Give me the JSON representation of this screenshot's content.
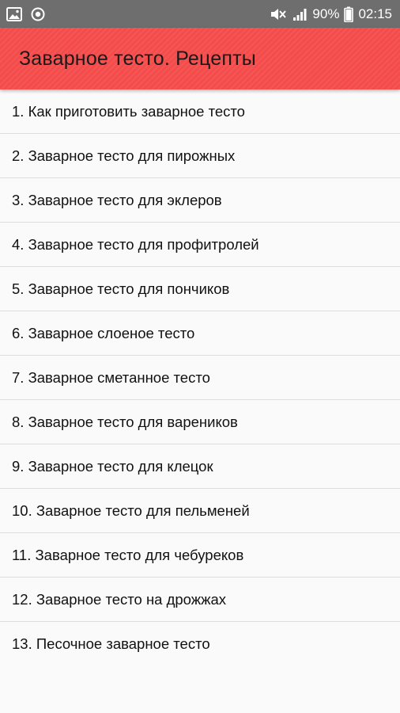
{
  "status_bar": {
    "icons_left": [
      "image-notification-icon",
      "sync-icon"
    ],
    "icons_right": [
      "mute-icon",
      "signal-icon"
    ],
    "battery": "90%",
    "time": "02:15"
  },
  "app_bar": {
    "title": "Заварное тесто. Рецепты",
    "color": "#f44b4b"
  },
  "recipes": [
    "1. Как приготовить заварное тесто",
    "2. Заварное тесто для пирожных",
    "3. Заварное тесто для эклеров",
    "4. Заварное тесто для профитролей",
    "5. Заварное тесто для пончиков",
    "6. Заварное слоеное тесто",
    "7. Заварное сметанное тесто",
    "8. Заварное тесто для вареников",
    "9. Заварное тесто для клецок",
    "10. Заварное тесто для пельменей",
    "11. Заварное тесто для чебуреков",
    "12. Заварное тесто на дрожжах",
    "13. Песочное заварное тесто"
  ]
}
